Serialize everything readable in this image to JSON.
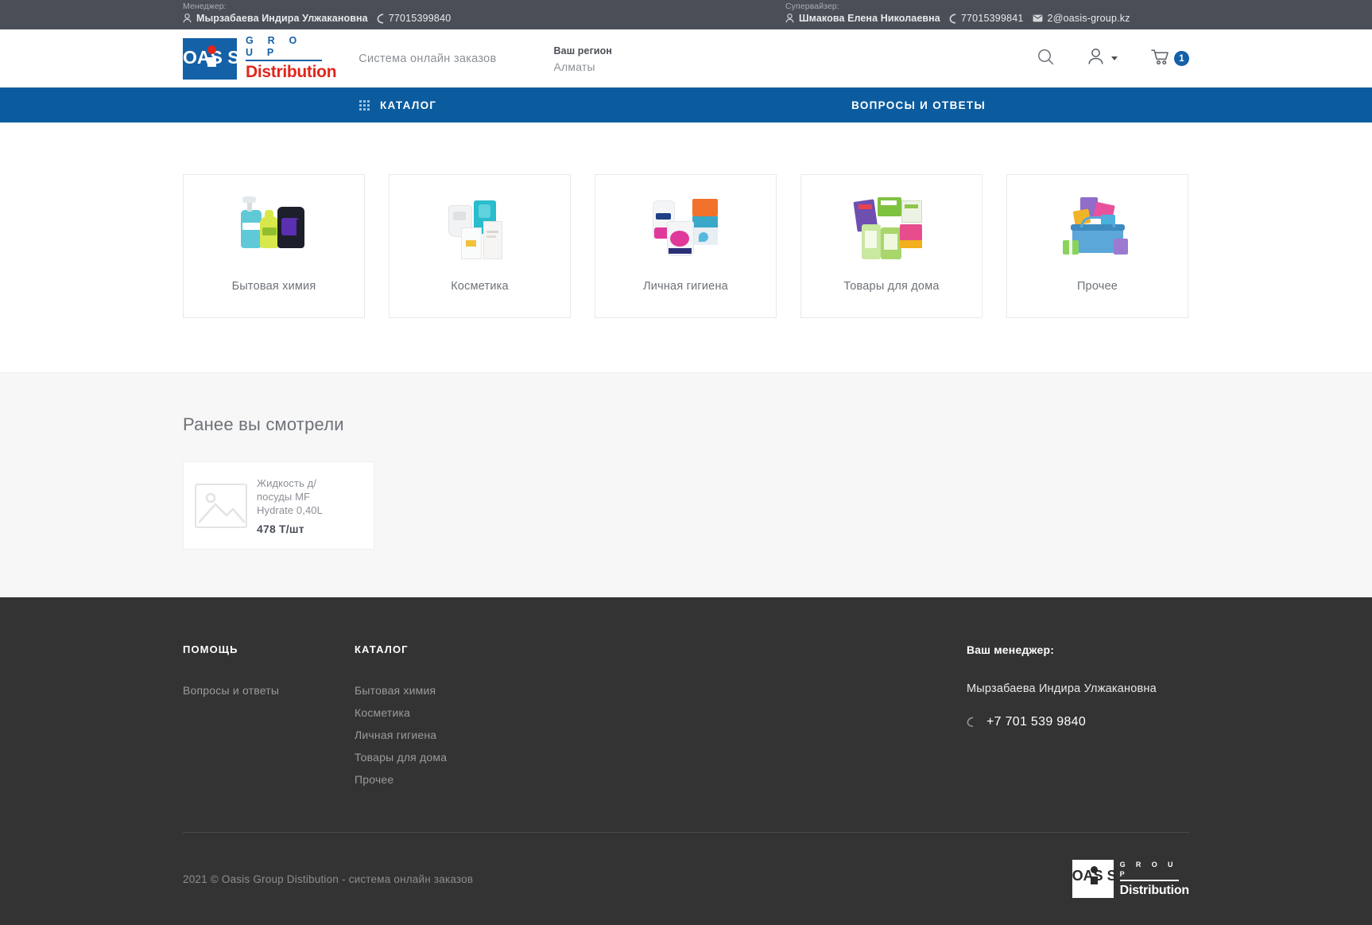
{
  "topbar": {
    "manager": {
      "role_label": "Менеджер:",
      "name": "Мырзабаева Индира Улжакановна",
      "phone": "77015399840",
      "person_icon": "person-icon",
      "phone_icon": "phone-icon"
    },
    "supervisor": {
      "role_label": "Супервайзер:",
      "name": "Шмакова Елена Николаевна",
      "phone": "77015399841",
      "email": "2@oasis-group.kz",
      "person_icon": "person-icon",
      "phone_icon": "phone-icon",
      "email_icon": "envelope-icon"
    }
  },
  "header": {
    "logo": {
      "mark_text_left": "OAS",
      "mark_text_right": "S",
      "group": "G R O U P",
      "distribution": "Distribution"
    },
    "tagline": "Система онлайн заказов",
    "region": {
      "title": "Ваш регион",
      "value": "Алматы"
    },
    "actions": {
      "search_icon": "search-icon",
      "account_icon": "user-icon",
      "cart_icon": "cart-icon",
      "cart_count": "1"
    }
  },
  "nav": {
    "catalog_label": "КАТАЛОГ",
    "catalog_icon": "grid-icon",
    "faq_label": "ВОПРОСЫ И ОТВЕТЫ"
  },
  "categories": [
    {
      "label": "Бытовая химия",
      "image_name": "household-chemicals-photo"
    },
    {
      "label": "Косметика",
      "image_name": "cosmetics-photo"
    },
    {
      "label": "Личная гигиена",
      "image_name": "personal-hygiene-photo"
    },
    {
      "label": "Товары для дома",
      "image_name": "home-goods-photo"
    },
    {
      "label": "Прочее",
      "image_name": "other-goods-photo"
    }
  ],
  "recent": {
    "title": "Ранее вы смотрели",
    "products": [
      {
        "name": "Жидкость д/посуды MF Hydrate 0,40L",
        "price": "478 Т/шт",
        "thumb_icon": "image-placeholder-icon"
      }
    ]
  },
  "footer": {
    "help": {
      "heading": "ПОМОЩЬ",
      "links": [
        "Вопросы и ответы"
      ]
    },
    "catalog": {
      "heading": "КАТАЛОГ",
      "links": [
        "Бытовая химия",
        "Косметика",
        "Личная гигиена",
        "Товары для дома",
        "Прочее"
      ]
    },
    "manager": {
      "heading": "Ваш менеджер:",
      "name": "Мырзабаева Индира Улжакановна",
      "phone": "+7 701 539 9840",
      "phone_icon": "phone-icon"
    },
    "copyright": "2021 © Oasis Group Distibution - система онлайн заказов",
    "logo": {
      "mark_text_left": "OAS",
      "mark_text_right": "S",
      "group": "G R O U P",
      "distribution": "Distribution"
    }
  },
  "colors": {
    "brand_blue": "#1461a8",
    "nav_blue": "#0b5c9e",
    "brand_red": "#e1251b",
    "topbar_gray": "#4a4f57",
    "footer_gray": "#333333"
  }
}
